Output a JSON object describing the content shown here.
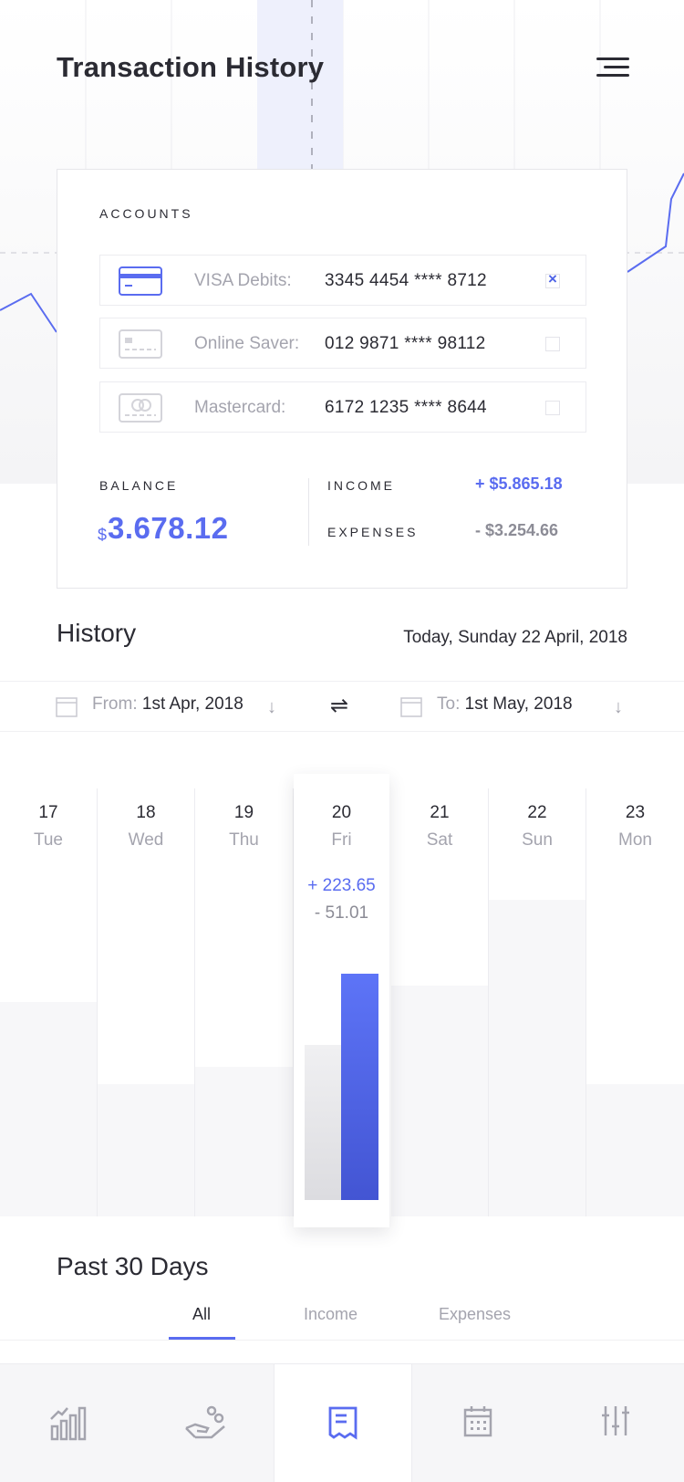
{
  "header": {
    "title": "Transaction History"
  },
  "accounts": {
    "label": "ACCOUNTS",
    "items": [
      {
        "name": "VISA Debits:",
        "number": "3345 4454 **** 8712",
        "selected": true,
        "icon": "visa-card-icon"
      },
      {
        "name": "Online Saver:",
        "number": "012 9871 **** 98112",
        "selected": false,
        "icon": "card-icon"
      },
      {
        "name": "Mastercard:",
        "number": "6172 1235 **** 8644",
        "selected": false,
        "icon": "mastercard-icon"
      }
    ]
  },
  "summary": {
    "balance_label": "BALANCE",
    "balance_currency": "$",
    "balance_value": "3.678.12",
    "income_label": "INCOME",
    "income_value": "+ $5.865.18",
    "expenses_label": "EXPENSES",
    "expenses_value": "- $3.254.66"
  },
  "history": {
    "title": "History",
    "date": "Today, Sunday 22 April, 2018",
    "from_label": "From:",
    "from_value": "1st Apr, 2018",
    "to_label": "To:",
    "to_value": "1st May, 2018",
    "swap_symbol": "⇌",
    "arrow": "↓"
  },
  "days": [
    {
      "num": "17",
      "name": "Tue",
      "level": 0.5
    },
    {
      "num": "18",
      "name": "Wed",
      "level": 0.31
    },
    {
      "num": "19",
      "name": "Thu",
      "level": 0.35
    },
    {
      "num": "20",
      "name": "Fri",
      "selected": true,
      "income": "+ 223.65",
      "expense": "- 51.01"
    },
    {
      "num": "21",
      "name": "Sat",
      "level": 0.54
    },
    {
      "num": "22",
      "name": "Sun",
      "level": 0.74
    },
    {
      "num": "23",
      "name": "Mon",
      "level": 0.31
    }
  ],
  "past": {
    "title": "Past 30 Days",
    "tabs": [
      "All",
      "Income",
      "Expenses"
    ],
    "active_tab": "All"
  },
  "nav": [
    {
      "icon": "chart-icon",
      "active": false
    },
    {
      "icon": "hand-coins-icon",
      "active": false
    },
    {
      "icon": "receipt-icon",
      "active": true
    },
    {
      "icon": "calendar-icon",
      "active": false
    },
    {
      "icon": "sliders-icon",
      "active": false
    }
  ],
  "colors": {
    "accent": "#5a6cf0",
    "text": "#2b2b33",
    "muted": "#a4a4ae"
  }
}
